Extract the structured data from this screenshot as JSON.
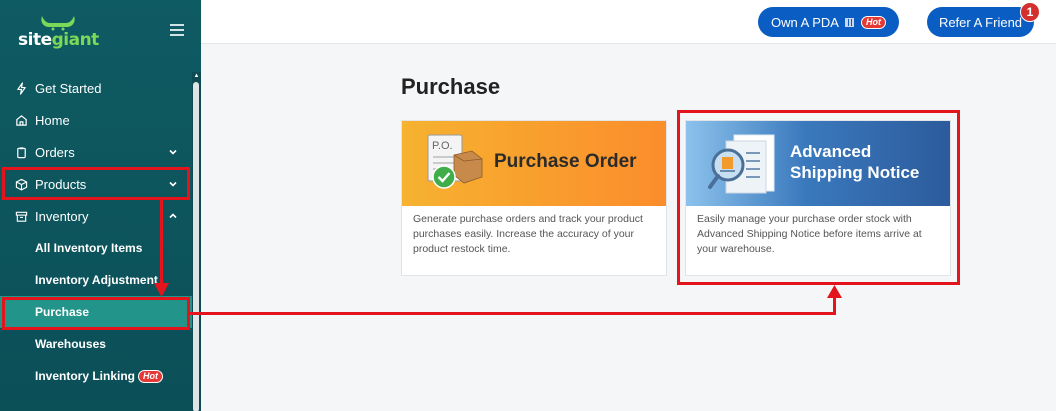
{
  "sidebar": {
    "logo": {
      "site": "site",
      "giant": "giant"
    },
    "items": [
      {
        "label": "Get Started"
      },
      {
        "label": "Home"
      },
      {
        "label": "Orders"
      },
      {
        "label": "Products"
      },
      {
        "label": "Inventory"
      }
    ],
    "sub_items": [
      {
        "label": "All Inventory Items"
      },
      {
        "label": "Inventory Adjustment"
      },
      {
        "label": "Purchase"
      },
      {
        "label": "Warehouses"
      },
      {
        "label": "Inventory Linking",
        "badge": "Hot"
      }
    ]
  },
  "topbar": {
    "pda_label": "Own A PDA",
    "pda_badge": "Hot",
    "refer_label": "Refer A Friend",
    "notification_count": "1"
  },
  "main": {
    "title": "Purchase",
    "cards": [
      {
        "banner_title": "Purchase Order",
        "banner_doc_text": "P.O.",
        "description": "Generate purchase orders and track your product purchases easily. Increase the accuracy of your product restock time."
      },
      {
        "banner_title_line1": "Advanced",
        "banner_title_line2": "Shipping Notice",
        "description": "Easily manage your purchase order stock with Advanced Shipping Notice before items arrive at your warehouse."
      }
    ]
  },
  "colors": {
    "sidebar_bg": "#0f5b63",
    "active_item": "#23948a",
    "pill_blue": "#0a5dc2",
    "annotation_red": "#e3141b"
  }
}
